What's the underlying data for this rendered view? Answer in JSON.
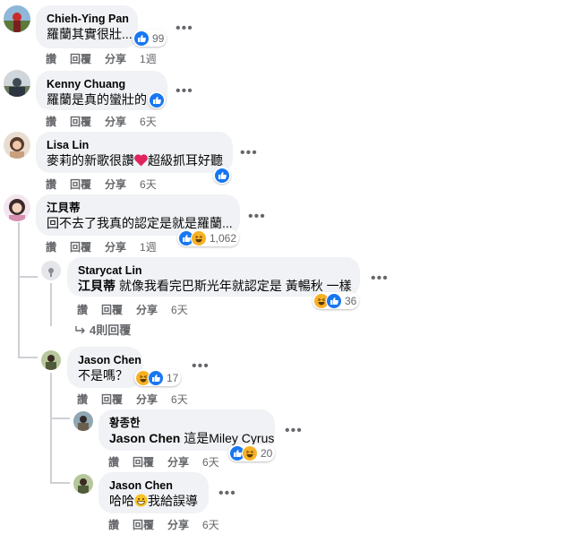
{
  "actions": {
    "like": "讚",
    "reply": "回覆",
    "share": "分享"
  },
  "more_glyph": "•••",
  "comments": [
    {
      "author": "Chieh-Ying Pan",
      "text": "羅蘭其實很壯...",
      "reactions_count": "99",
      "time": "1週"
    },
    {
      "author": "Kenny Chuang",
      "text": "羅蘭是真的蠻壯的",
      "time": "6天"
    },
    {
      "author": "Lisa Lin",
      "text_a": "麥莉的新歌很讚",
      "text_b": "超級抓耳好聽",
      "time": "6天"
    },
    {
      "author": "江貝蒂",
      "text": "回不去了我真的認定是就是羅蘭...",
      "reactions_count": "1,062",
      "time": "1週"
    }
  ],
  "replies": [
    {
      "author": "Starycat Lin",
      "mention": "江貝蒂",
      "text": "就像我看完巴斯光年就認定是 黃暢秋 一樣",
      "reactions_count": "36",
      "time": "6天"
    },
    {
      "author": "Jason Chen",
      "text": "不是嗎？",
      "reactions_count": "17",
      "time": "6天"
    },
    {
      "author": "황종한",
      "mention": "Jason Chen",
      "text": "這是Miley Cyrus",
      "reactions_count": "20",
      "time": "6天"
    },
    {
      "author": "Jason Chen",
      "text_a": "哈哈",
      "text_b": "我給誤導",
      "time": "6天"
    }
  ],
  "view_replies": "4則回覆",
  "colors": {
    "like_blue": "#1877f2",
    "heart_red": "#f33e58",
    "haha_yellow": "#f7b125",
    "bubble": "#f0f2f5",
    "meta_gray": "#65676b"
  }
}
